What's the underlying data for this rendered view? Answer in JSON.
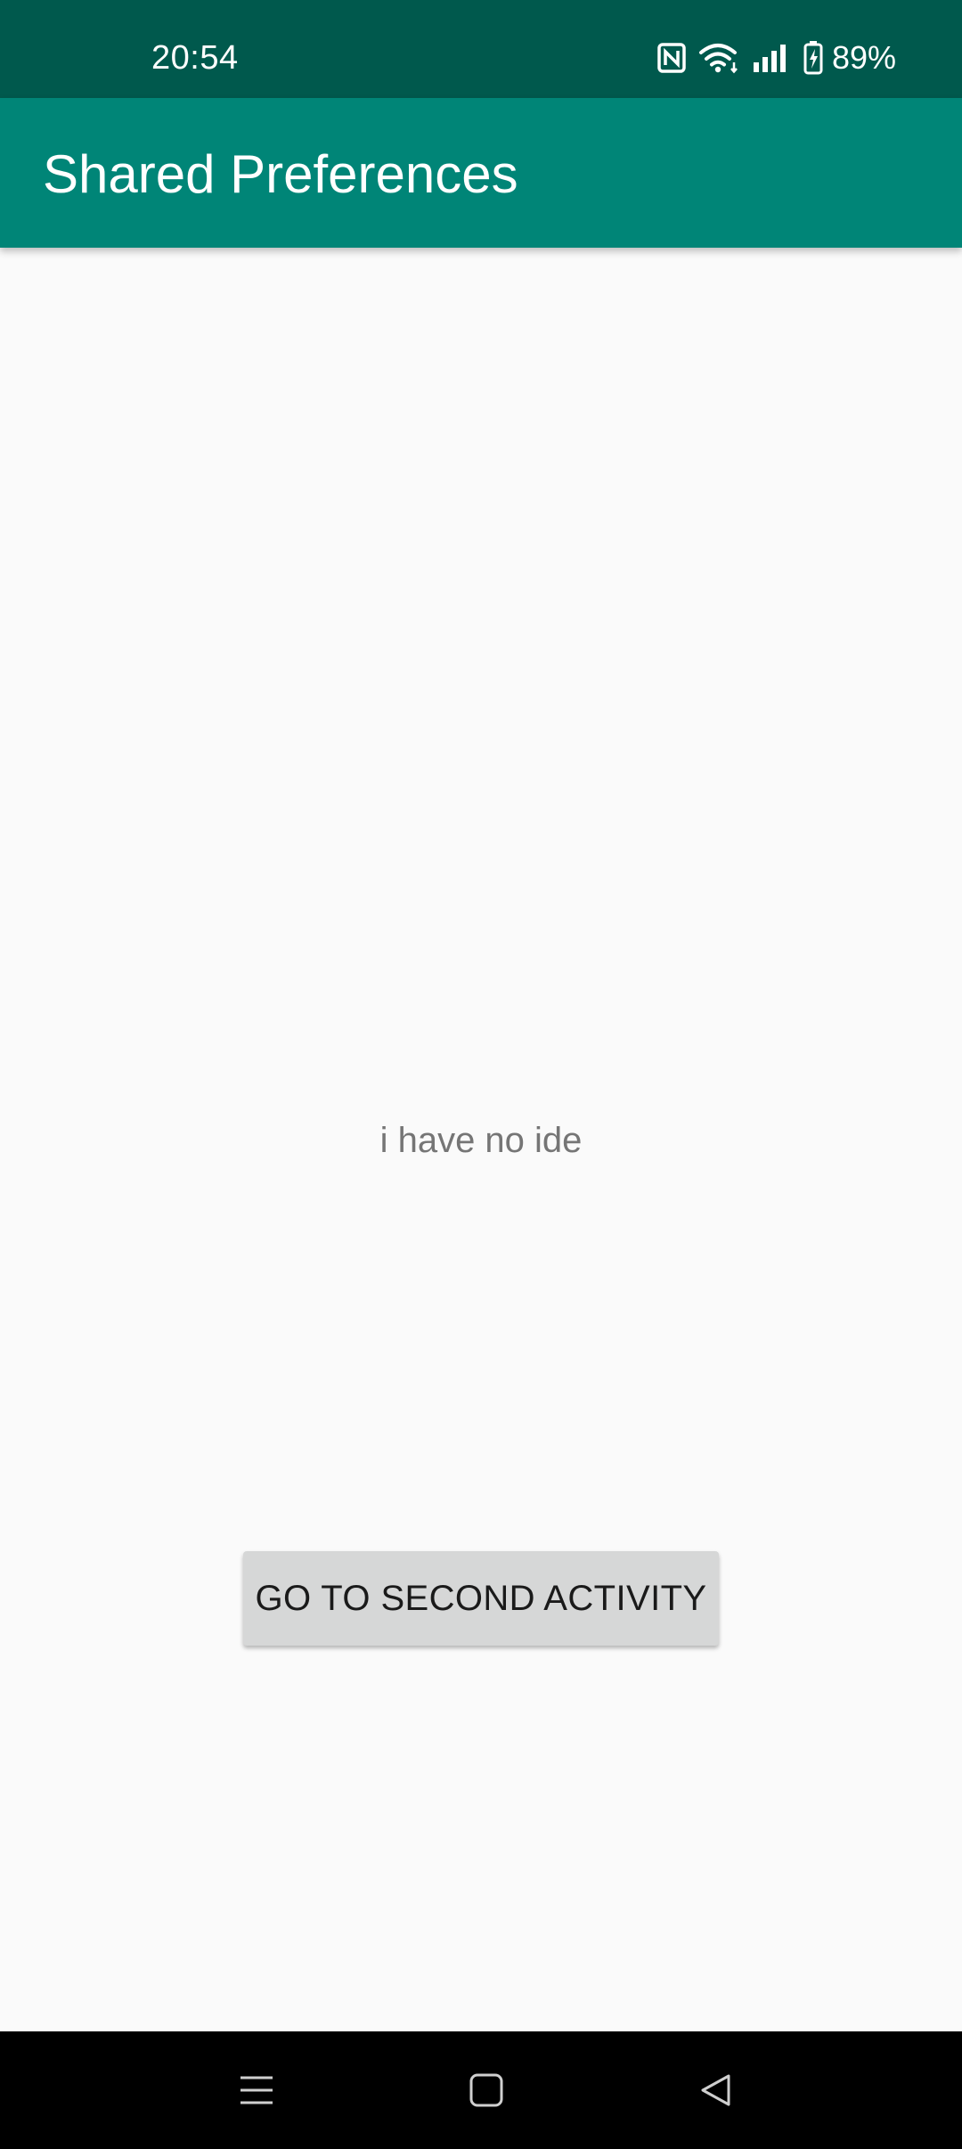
{
  "status_bar": {
    "time": "20:54",
    "battery_percent": "89%",
    "icons": [
      "nfc-icon",
      "wifi-icon",
      "signal-icon",
      "battery-charging-icon"
    ],
    "background_color": "#00594d"
  },
  "app_bar": {
    "title": "Shared Preferences",
    "background_color": "#008577"
  },
  "main": {
    "text": "i have no ide",
    "button_label": "GO TO SECOND ACTIVITY"
  },
  "nav_bar": {
    "icons": [
      "menu-icon",
      "home-icon",
      "back-icon"
    ]
  }
}
